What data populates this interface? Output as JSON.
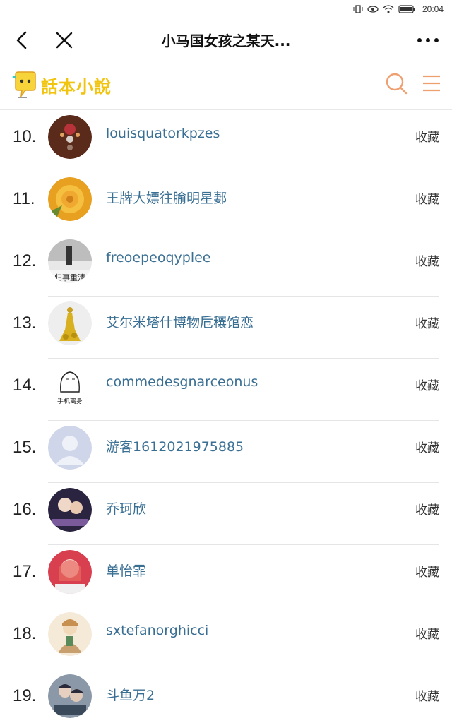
{
  "status_bar": {
    "time": "20:04"
  },
  "nav": {
    "title": "小马国女孩之某天..."
  },
  "header": {
    "logo_text": "話本小說"
  },
  "rows": [
    {
      "rank": "10.",
      "name": "louisquatorkpzes",
      "action": "收藏"
    },
    {
      "rank": "11.",
      "name": "王牌大嫖往腧明星郪",
      "action": "收藏"
    },
    {
      "rank": "12.",
      "name": "freoepeoqyplee",
      "action": "收藏"
    },
    {
      "rank": "13.",
      "name": "艾尔米塔什博物卮穰馆恋",
      "action": "收藏"
    },
    {
      "rank": "14.",
      "name": "commedesgnarceonus",
      "action": "收藏"
    },
    {
      "rank": "15.",
      "name": "游客1612021975885",
      "action": "收藏"
    },
    {
      "rank": "16.",
      "name": "乔珂欣",
      "action": "收藏"
    },
    {
      "rank": "17.",
      "name": "单怡霏",
      "action": "收藏"
    },
    {
      "rank": "18.",
      "name": "sxtefanorghicci",
      "action": "收藏"
    },
    {
      "rank": "19.",
      "name": "斗鱼万2",
      "action": "收藏"
    }
  ],
  "colors": {
    "name_link": "#3a6f94",
    "accent": "#f0a070",
    "logo": "#f1c40f"
  }
}
